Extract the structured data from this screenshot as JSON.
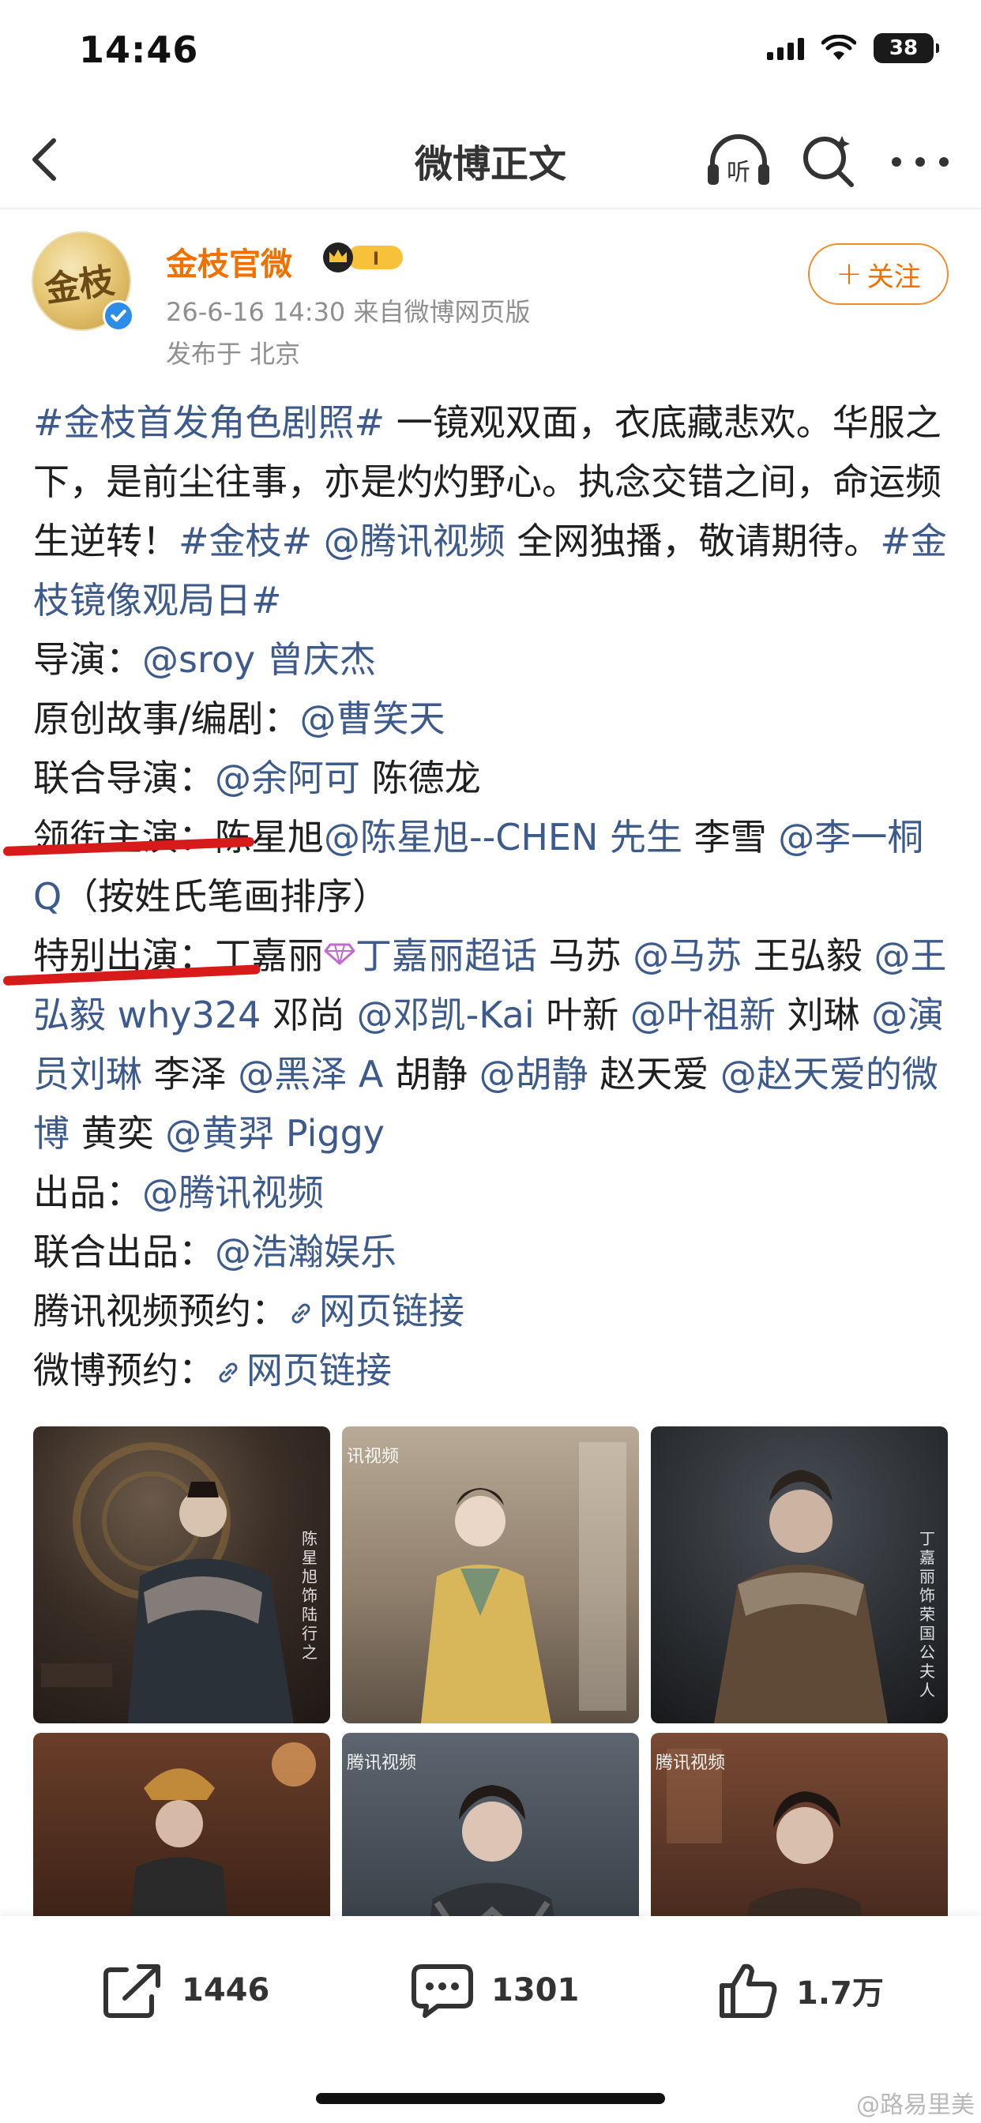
{
  "status_bar": {
    "time": "14:46",
    "battery": "38"
  },
  "nav": {
    "title": "微博正文",
    "listen_label": "听"
  },
  "author": {
    "avatar_text": "金枝",
    "name": "金枝官微",
    "vip_level": "I",
    "meta": "26-6-16 14:30  来自微博网页版",
    "location": "发布于 北京",
    "follow_label": "关注"
  },
  "post": {
    "p1": {
      "topic1": "#金枝首发角色剧照#",
      "t1": " 一镜观双面，衣底藏悲欢。华服之下，是前尘往事，亦是灼灼野心。执念交错之间，命运频生逆转！",
      "topic2": "#金枝#",
      "t2": " ",
      "mention1": "@腾讯视频",
      "t3": " 全网独播，敬请期待。",
      "topic3": "#金枝镜像观局日#"
    },
    "director": {
      "label": "导演：",
      "mention": "@sroy 曾庆杰"
    },
    "story": {
      "label": "原创故事/编剧：",
      "mention": "@曹笑天"
    },
    "co_director": {
      "label": "联合导演：",
      "mention": "@余阿可",
      "t": " 陈德龙"
    },
    "lead": {
      "label": "领衔主演：",
      "t1": "陈星旭",
      "m1": "@陈星旭--CHEN 先生",
      "t2": " 李雪 ",
      "m2": "@李一桐 Q",
      "t3": "（按姓氏笔画排序）"
    },
    "special": {
      "label": "特别出演：",
      "t1": "丁嘉丽",
      "m1": "丁嘉丽超话",
      "t2": " 马苏 ",
      "m2": "@马苏",
      "t3": " 王弘毅 ",
      "m3": "@王弘毅 why324",
      "t4": " 邓尚 ",
      "m4": "@邓凯-Kai",
      "t5": " 叶新 ",
      "m5": "@叶祖新",
      "t6": " 刘琳 ",
      "m6": "@演员刘琳",
      "t7": " 李泽 ",
      "m7": "@黑泽 A",
      "t8": " 胡静 ",
      "m8": "@胡静",
      "t9": " 赵天爱 ",
      "m9": "@赵天爱的微博",
      "t10": " 黄奕 ",
      "m10": "@黄羿 Piggy"
    },
    "producer": {
      "label": "出品：",
      "mention": "@腾讯视频"
    },
    "co_producer": {
      "label": "联合出品：",
      "mention": "@浩瀚娱乐"
    },
    "tencent_reserve": {
      "label": "腾讯视频预约：",
      "link": "网页链接"
    },
    "weibo_reserve": {
      "label": "微博预约：",
      "link": "网页链接"
    }
  },
  "photos": [
    {
      "watermark": "",
      "side_text": "陈星旭 饰 陆行之"
    },
    {
      "watermark": "讯视频",
      "side_text": ""
    },
    {
      "watermark": "",
      "side_text": "丁嘉丽 饰 荣国公夫人"
    },
    {
      "watermark": "",
      "side_text": ""
    },
    {
      "watermark": "腾讯视频",
      "side_text": ""
    },
    {
      "watermark": "腾讯视频",
      "side_text": ""
    }
  ],
  "actions": {
    "repost": "1446",
    "comment": "1301",
    "like": "1.7万"
  },
  "watermark": "@路易里美",
  "colors": {
    "accent_orange": "#f07000",
    "link_blue": "#3d5a8c",
    "underline_red": "#d71a1a"
  }
}
